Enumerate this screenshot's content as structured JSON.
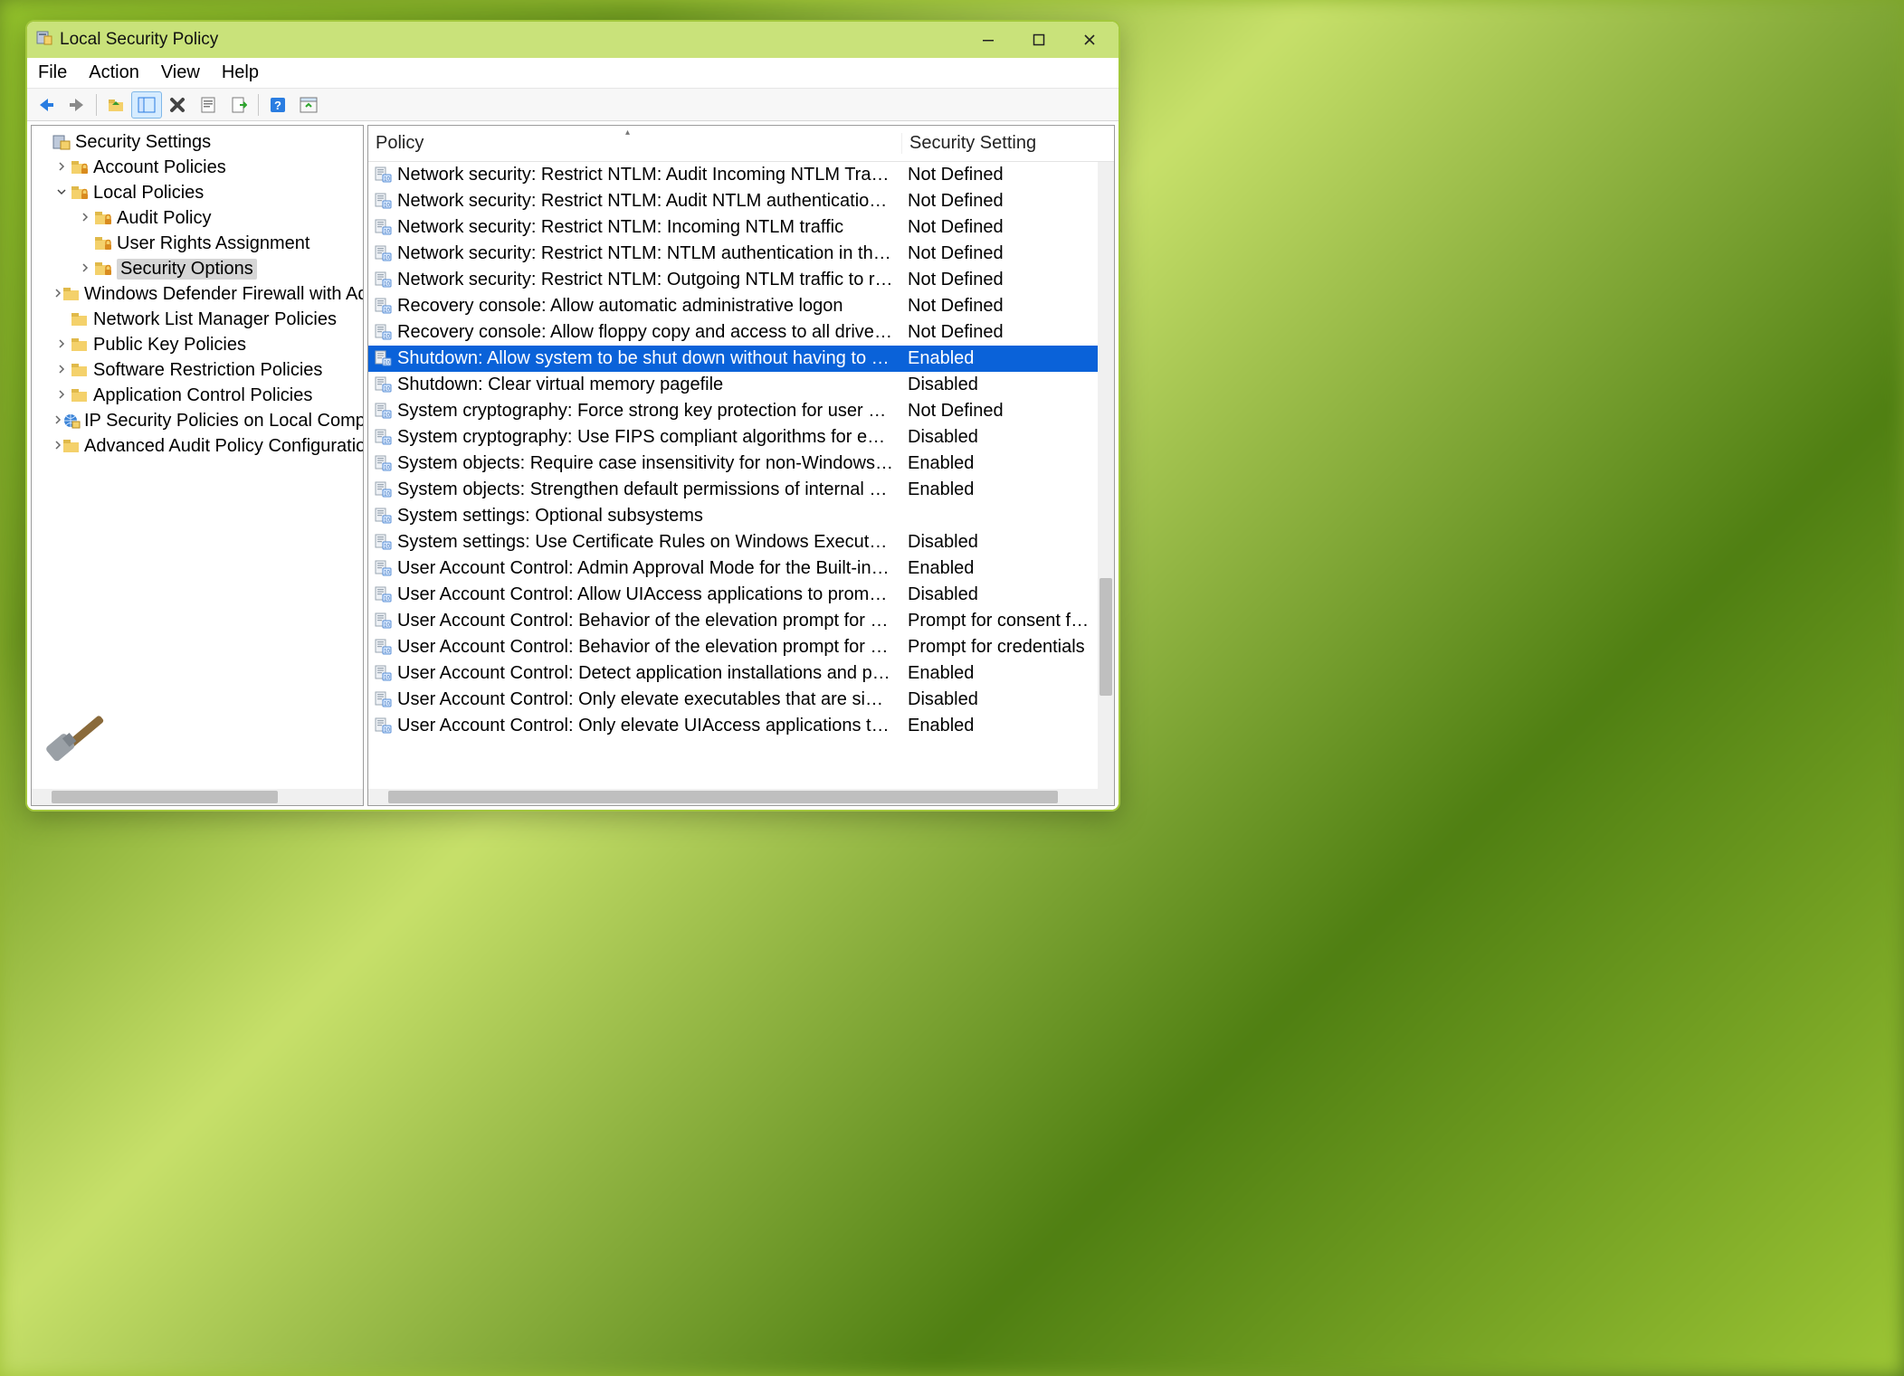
{
  "window": {
    "title": "Local Security Policy"
  },
  "menu": {
    "file": "File",
    "action": "Action",
    "view": "View",
    "help": "Help"
  },
  "toolbar_icons": {
    "back": "back-arrow-icon",
    "forward": "forward-arrow-icon",
    "up": "up-folder-icon",
    "show_hide": "show-hide-tree-icon",
    "delete": "delete-icon",
    "properties": "properties-icon",
    "export": "export-list-icon",
    "help": "help-icon",
    "refresh": "refresh-icon"
  },
  "tree": {
    "root": "Security Settings",
    "items": [
      {
        "label": "Account Policies",
        "expand": "collapsed",
        "depth": 1,
        "icon": "folder-lock"
      },
      {
        "label": "Local Policies",
        "expand": "expanded",
        "depth": 1,
        "icon": "folder-lock"
      },
      {
        "label": "Audit Policy",
        "expand": "collapsed",
        "depth": 2,
        "icon": "folder-lock"
      },
      {
        "label": "User Rights Assignment",
        "expand": "none",
        "depth": 2,
        "icon": "folder-lock"
      },
      {
        "label": "Security Options",
        "expand": "collapsed",
        "depth": 2,
        "icon": "folder-lock",
        "selected": true
      },
      {
        "label": "Windows Defender Firewall with Advan",
        "expand": "collapsed",
        "depth": 1,
        "icon": "folder"
      },
      {
        "label": "Network List Manager Policies",
        "expand": "none",
        "depth": 1,
        "icon": "folder"
      },
      {
        "label": "Public Key Policies",
        "expand": "collapsed",
        "depth": 1,
        "icon": "folder"
      },
      {
        "label": "Software Restriction Policies",
        "expand": "collapsed",
        "depth": 1,
        "icon": "folder"
      },
      {
        "label": "Application Control Policies",
        "expand": "collapsed",
        "depth": 1,
        "icon": "folder"
      },
      {
        "label": "IP Security Policies on Local Computer",
        "expand": "collapsed",
        "depth": 1,
        "icon": "globe"
      },
      {
        "label": "Advanced Audit Policy Configuration",
        "expand": "collapsed",
        "depth": 1,
        "icon": "folder"
      }
    ]
  },
  "columns": {
    "policy": "Policy",
    "setting": "Security Setting"
  },
  "policies": [
    {
      "name": "Network security: Restrict NTLM: Audit Incoming NTLM Traffic",
      "value": "Not Defined"
    },
    {
      "name": "Network security: Restrict NTLM: Audit NTLM authentication in this do...",
      "value": "Not Defined"
    },
    {
      "name": "Network security: Restrict NTLM: Incoming NTLM traffic",
      "value": "Not Defined"
    },
    {
      "name": "Network security: Restrict NTLM: NTLM authentication in this domain",
      "value": "Not Defined"
    },
    {
      "name": "Network security: Restrict NTLM: Outgoing NTLM traffic to remote ser...",
      "value": "Not Defined"
    },
    {
      "name": "Recovery console: Allow automatic administrative logon",
      "value": "Not Defined"
    },
    {
      "name": "Recovery console: Allow floppy copy and access to all drives and all fo...",
      "value": "Not Defined"
    },
    {
      "name": "Shutdown: Allow system to be shut down without having to log on",
      "value": "Enabled",
      "selected": true
    },
    {
      "name": "Shutdown: Clear virtual memory pagefile",
      "value": "Disabled"
    },
    {
      "name": "System cryptography: Force strong key protection for user keys store...",
      "value": "Not Defined"
    },
    {
      "name": "System cryptography: Use FIPS compliant algorithms for encryption, h...",
      "value": "Disabled"
    },
    {
      "name": "System objects: Require case insensitivity for non-Windows subsystems",
      "value": "Enabled"
    },
    {
      "name": "System objects: Strengthen default permissions of internal system obj...",
      "value": "Enabled"
    },
    {
      "name": "System settings: Optional subsystems",
      "value": ""
    },
    {
      "name": "System settings: Use Certificate Rules on Windows Executables for Sof...",
      "value": "Disabled"
    },
    {
      "name": "User Account Control: Admin Approval Mode for the Built-in Administ...",
      "value": "Enabled"
    },
    {
      "name": "User Account Control: Allow UIAccess applications to prompt for elev...",
      "value": "Disabled"
    },
    {
      "name": "User Account Control: Behavior of the elevation prompt for administr...",
      "value": "Prompt for consent for no..."
    },
    {
      "name": "User Account Control: Behavior of the elevation prompt for standard ...",
      "value": "Prompt for credentials"
    },
    {
      "name": "User Account Control: Detect application installations and prompt for...",
      "value": "Enabled"
    },
    {
      "name": "User Account Control: Only elevate executables that are signed and va...",
      "value": "Disabled"
    },
    {
      "name": "User Account Control: Only elevate UIAccess applications that are inst...",
      "value": "Enabled"
    }
  ]
}
